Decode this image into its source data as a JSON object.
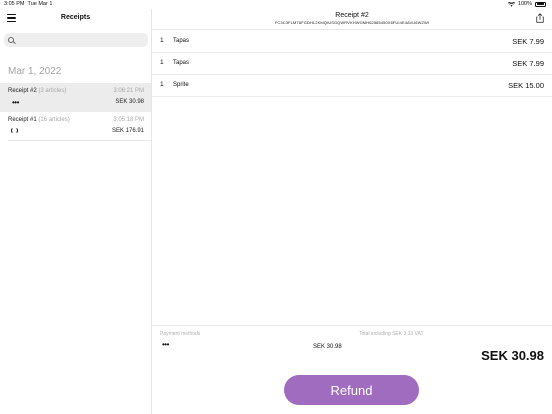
{
  "status_bar": {
    "time": "3:05 PM",
    "date": "Tue Mar 1",
    "battery": "100%"
  },
  "sidebar": {
    "title": "Receipts",
    "search": {
      "placeholder": "",
      "value": ""
    },
    "date_header": "Mar 1, 2022",
    "receipts": [
      {
        "name": "Receipt #2",
        "count": "(3 articles)",
        "time": "3:06:21 PM",
        "amount": "SEK 30.98",
        "payment_icon": "dots-icon",
        "selected": true
      },
      {
        "name": "Receipt #1",
        "count": "(16 articles)",
        "time": "3:05:18 PM",
        "amount": "SEK 176.91",
        "payment_icon": "spinner-icon",
        "selected": false
      }
    ]
  },
  "main": {
    "title": "Receipt #2",
    "receipt_id": "FC3C3FLMT6FGDHL2KMQIUSGQWRVKHWGMH62585450X6FUI4E4AVU6WZWI",
    "items": [
      {
        "qty": "1",
        "name": "Tapas",
        "price": "SEK 7.99"
      },
      {
        "qty": "1",
        "name": "Tapas",
        "price": "SEK 7.99"
      },
      {
        "qty": "1",
        "name": "Sprite",
        "price": "SEK 15.00"
      }
    ],
    "footer": {
      "payment_methods_label": "Payment methods",
      "total_label": "Total including SEK 3.33 VAT",
      "payment_amount": "SEK 30.98",
      "grand_total": "SEK 30.98",
      "refund_label": "Refund"
    }
  },
  "colors": {
    "accent": "#a06cc0",
    "selected_row": "#ececec",
    "muted_text": "#a8a8a8"
  }
}
